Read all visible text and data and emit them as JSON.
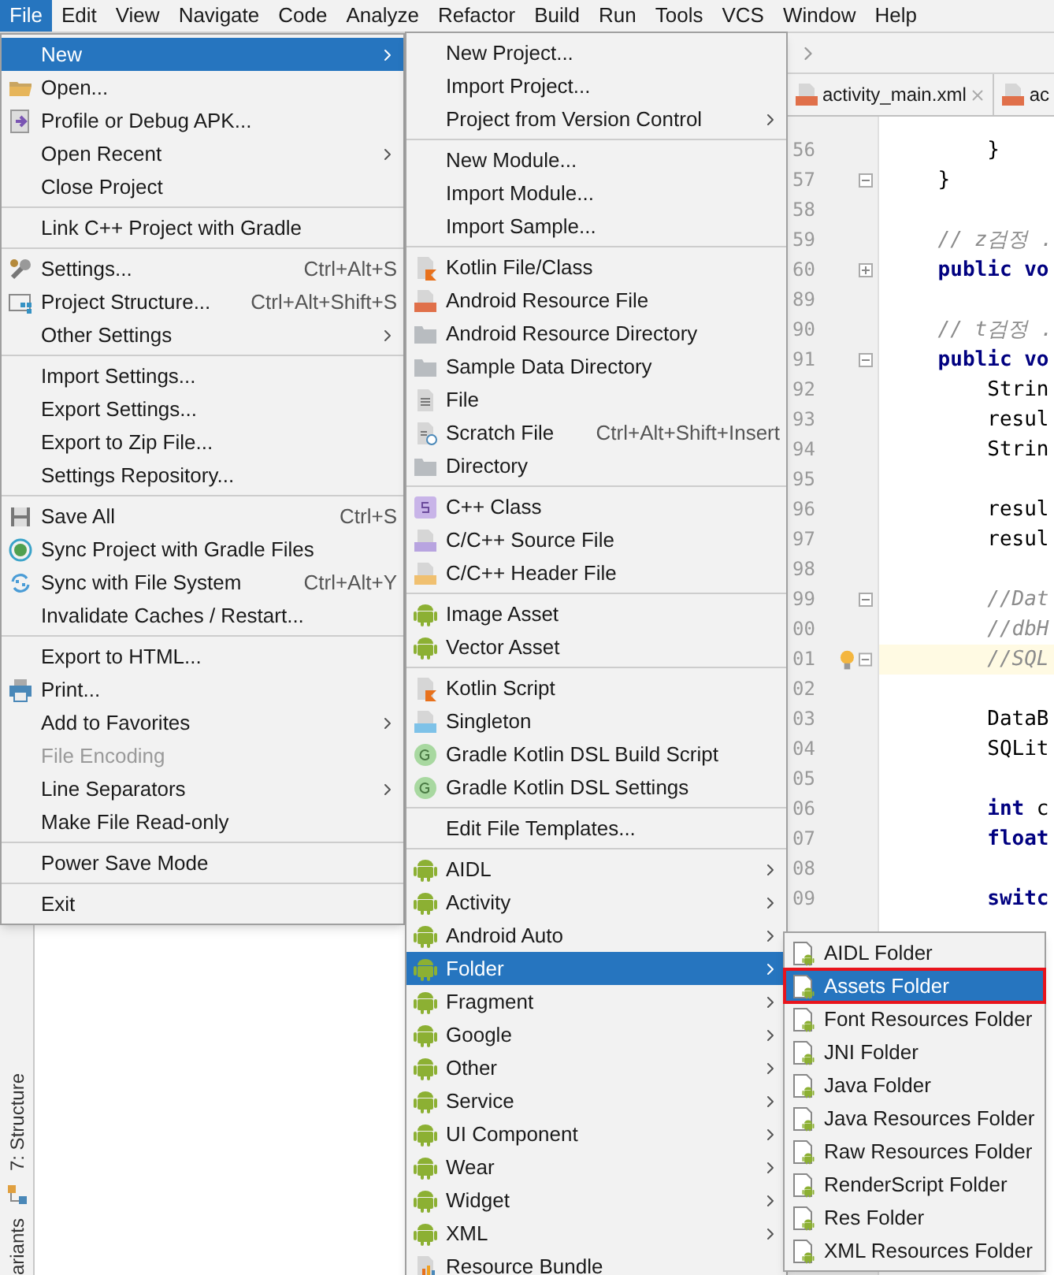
{
  "menu_bar": [
    {
      "label": "File",
      "selected": true
    },
    {
      "label": "Edit",
      "selected": false
    },
    {
      "label": "View",
      "selected": false
    },
    {
      "label": "Navigate",
      "selected": false
    },
    {
      "label": "Code",
      "selected": false
    },
    {
      "label": "Analyze",
      "selected": false
    },
    {
      "label": "Refactor",
      "selected": false
    },
    {
      "label": "Build",
      "selected": false
    },
    {
      "label": "Run",
      "selected": false
    },
    {
      "label": "Tools",
      "selected": false
    },
    {
      "label": "VCS",
      "selected": false
    },
    {
      "label": "Window",
      "selected": false
    },
    {
      "label": "Help",
      "selected": false
    }
  ],
  "tool_strip": {
    "labels": [
      "7: Structure",
      "ariants"
    ]
  },
  "editor": {
    "tabs": [
      {
        "label": "activity_main.xml",
        "closable": true
      },
      {
        "label": "ac",
        "closable": false
      }
    ],
    "lines": [
      {
        "number": "56",
        "kind": "code",
        "text": "        }",
        "foldable": false,
        "current": false
      },
      {
        "number": "57",
        "kind": "code",
        "text": "    }",
        "foldable": true,
        "collapsed": false,
        "current": false
      },
      {
        "number": "58",
        "kind": "blank",
        "foldable": false,
        "current": false
      },
      {
        "number": "59",
        "kind": "comment",
        "text": "    // z검정 .",
        "foldable": false,
        "current": false
      },
      {
        "number": "60",
        "kind": "keyword",
        "text": "    public vo",
        "foldable": true,
        "collapsed": true,
        "current": false
      },
      {
        "number": "89",
        "kind": "blank",
        "foldable": false,
        "current": false
      },
      {
        "number": "90",
        "kind": "comment",
        "text": "    // t검정 .",
        "foldable": false,
        "current": false
      },
      {
        "number": "91",
        "kind": "keyword",
        "text": "    public vo",
        "foldable": true,
        "collapsed": false,
        "current": false
      },
      {
        "number": "92",
        "kind": "code",
        "text": "        Strin",
        "foldable": false,
        "current": false
      },
      {
        "number": "93",
        "kind": "code",
        "text": "        resul",
        "foldable": false,
        "current": false
      },
      {
        "number": "94",
        "kind": "code",
        "text": "        Strin",
        "foldable": false,
        "current": false
      },
      {
        "number": "95",
        "kind": "blank",
        "foldable": false,
        "current": false
      },
      {
        "number": "96",
        "kind": "code",
        "text": "        resul",
        "foldable": false,
        "current": false
      },
      {
        "number": "97",
        "kind": "code",
        "text": "        resul",
        "foldable": false,
        "current": false
      },
      {
        "number": "98",
        "kind": "blank",
        "foldable": false,
        "current": false
      },
      {
        "number": "99",
        "kind": "comment",
        "text": "        //Dat",
        "foldable": true,
        "collapsed": false,
        "current": false
      },
      {
        "number": "00",
        "kind": "comment",
        "text": "        //dbH",
        "foldable": false,
        "current": false
      },
      {
        "number": "01",
        "kind": "comment",
        "text": "        //SQL",
        "foldable": true,
        "collapsed": false,
        "current": true
      },
      {
        "number": "02",
        "kind": "blank",
        "foldable": false,
        "current": false
      },
      {
        "number": "03",
        "kind": "code",
        "text": "        DataB",
        "foldable": false,
        "current": false
      },
      {
        "number": "04",
        "kind": "code",
        "text": "        SQLit",
        "foldable": false,
        "current": false
      },
      {
        "number": "05",
        "kind": "blank",
        "foldable": false,
        "current": false
      },
      {
        "number": "06",
        "kind": "code",
        "text": "        **int** c",
        "foldable": false,
        "current": false
      },
      {
        "number": "07",
        "kind": "keyword",
        "text": "        float",
        "foldable": false,
        "current": false
      },
      {
        "number": "08",
        "kind": "blank",
        "foldable": false,
        "current": false
      },
      {
        "number": "09",
        "kind": "keyword",
        "text": "        switc",
        "foldable": false,
        "current": false
      }
    ]
  },
  "file_menu": [
    {
      "kind": "item",
      "label": "New",
      "submenu": true,
      "disabled": false,
      "selected": true
    },
    {
      "kind": "item",
      "label": "Open...",
      "submenu": false,
      "disabled": false,
      "selected": false
    },
    {
      "kind": "item",
      "label": "Profile or Debug APK...",
      "submenu": false,
      "disabled": false,
      "selected": false
    },
    {
      "kind": "item",
      "label": "Open Recent",
      "submenu": true,
      "disabled": false,
      "selected": false
    },
    {
      "kind": "item",
      "label": "Close Project",
      "submenu": false,
      "disabled": false,
      "selected": false
    },
    {
      "kind": "separator"
    },
    {
      "kind": "item",
      "label": "Link C++ Project with Gradle",
      "submenu": false,
      "disabled": false,
      "selected": false
    },
    {
      "kind": "separator"
    },
    {
      "kind": "item",
      "label": "Settings...",
      "shortcut": "Ctrl+Alt+S",
      "submenu": false,
      "disabled": false,
      "selected": false
    },
    {
      "kind": "item",
      "label": "Project Structure...",
      "shortcut": "Ctrl+Alt+Shift+S",
      "submenu": false,
      "disabled": false,
      "selected": false
    },
    {
      "kind": "item",
      "label": "Other Settings",
      "submenu": true,
      "disabled": false,
      "selected": false
    },
    {
      "kind": "separator"
    },
    {
      "kind": "item",
      "label": "Import Settings...",
      "submenu": false,
      "disabled": false,
      "selected": false
    },
    {
      "kind": "item",
      "label": "Export Settings...",
      "submenu": false,
      "disabled": false,
      "selected": false
    },
    {
      "kind": "item",
      "label": "Export to Zip File...",
      "submenu": false,
      "disabled": false,
      "selected": false
    },
    {
      "kind": "item",
      "label": "Settings Repository...",
      "submenu": false,
      "disabled": false,
      "selected": false
    },
    {
      "kind": "separator"
    },
    {
      "kind": "item",
      "label": "Save All",
      "shortcut": "Ctrl+S",
      "submenu": false,
      "disabled": false,
      "selected": false
    },
    {
      "kind": "item",
      "label": "Sync Project with Gradle Files",
      "submenu": false,
      "disabled": false,
      "selected": false
    },
    {
      "kind": "item",
      "label": "Sync with File System",
      "shortcut": "Ctrl+Alt+Y",
      "submenu": false,
      "disabled": false,
      "selected": false
    },
    {
      "kind": "item",
      "label": "Invalidate Caches / Restart...",
      "submenu": false,
      "disabled": false,
      "selected": false
    },
    {
      "kind": "separator"
    },
    {
      "kind": "item",
      "label": "Export to HTML...",
      "submenu": false,
      "disabled": false,
      "selected": false
    },
    {
      "kind": "item",
      "label": "Print...",
      "submenu": false,
      "disabled": false,
      "selected": false
    },
    {
      "kind": "item",
      "label": "Add to Favorites",
      "submenu": true,
      "disabled": false,
      "selected": false
    },
    {
      "kind": "item",
      "label": "File Encoding",
      "submenu": false,
      "disabled": true,
      "selected": false
    },
    {
      "kind": "item",
      "label": "Line Separators",
      "submenu": true,
      "disabled": false,
      "selected": false
    },
    {
      "kind": "item",
      "label": "Make File Read-only",
      "submenu": false,
      "disabled": false,
      "selected": false
    },
    {
      "kind": "separator"
    },
    {
      "kind": "item",
      "label": "Power Save Mode",
      "submenu": false,
      "disabled": false,
      "selected": false
    },
    {
      "kind": "separator"
    },
    {
      "kind": "item",
      "label": "Exit",
      "submenu": false,
      "disabled": false,
      "selected": false
    }
  ],
  "new_menu": [
    {
      "kind": "item",
      "label": "New Project...",
      "submenu": false,
      "selected": false
    },
    {
      "kind": "item",
      "label": "Import Project...",
      "submenu": false,
      "selected": false
    },
    {
      "kind": "item",
      "label": "Project from Version Control",
      "submenu": true,
      "selected": false
    },
    {
      "kind": "separator"
    },
    {
      "kind": "item",
      "label": "New Module...",
      "submenu": false,
      "selected": false
    },
    {
      "kind": "item",
      "label": "Import Module...",
      "submenu": false,
      "selected": false
    },
    {
      "kind": "item",
      "label": "Import Sample...",
      "submenu": false,
      "selected": false
    },
    {
      "kind": "separator"
    },
    {
      "kind": "item",
      "label": "Kotlin File/Class",
      "submenu": false,
      "selected": false
    },
    {
      "kind": "item",
      "label": "Android Resource File",
      "submenu": false,
      "selected": false
    },
    {
      "kind": "item",
      "label": "Android Resource Directory",
      "submenu": false,
      "selected": false
    },
    {
      "kind": "item",
      "label": "Sample Data Directory",
      "submenu": false,
      "selected": false
    },
    {
      "kind": "item",
      "label": "File",
      "submenu": false,
      "selected": false
    },
    {
      "kind": "item",
      "label": "Scratch File",
      "shortcut": "Ctrl+Alt+Shift+Insert",
      "submenu": false,
      "selected": false
    },
    {
      "kind": "item",
      "label": "Directory",
      "submenu": false,
      "selected": false
    },
    {
      "kind": "separator"
    },
    {
      "kind": "item",
      "label": "C++ Class",
      "submenu": false,
      "selected": false
    },
    {
      "kind": "item",
      "label": "C/C++ Source File",
      "submenu": false,
      "selected": false
    },
    {
      "kind": "item",
      "label": "C/C++ Header File",
      "submenu": false,
      "selected": false
    },
    {
      "kind": "separator"
    },
    {
      "kind": "item",
      "label": "Image Asset",
      "submenu": false,
      "selected": false
    },
    {
      "kind": "item",
      "label": "Vector Asset",
      "submenu": false,
      "selected": false
    },
    {
      "kind": "separator"
    },
    {
      "kind": "item",
      "label": "Kotlin Script",
      "submenu": false,
      "selected": false
    },
    {
      "kind": "item",
      "label": "Singleton",
      "submenu": false,
      "selected": false
    },
    {
      "kind": "item",
      "label": "Gradle Kotlin DSL Build Script",
      "submenu": false,
      "selected": false
    },
    {
      "kind": "item",
      "label": "Gradle Kotlin DSL Settings",
      "submenu": false,
      "selected": false
    },
    {
      "kind": "separator"
    },
    {
      "kind": "item",
      "label": "Edit File Templates...",
      "submenu": false,
      "selected": false
    },
    {
      "kind": "separator"
    },
    {
      "kind": "item",
      "label": "AIDL",
      "submenu": true,
      "selected": false
    },
    {
      "kind": "item",
      "label": "Activity",
      "submenu": true,
      "selected": false
    },
    {
      "kind": "item",
      "label": "Android Auto",
      "submenu": true,
      "selected": false
    },
    {
      "kind": "item",
      "label": "Folder",
      "submenu": true,
      "selected": true
    },
    {
      "kind": "item",
      "label": "Fragment",
      "submenu": true,
      "selected": false
    },
    {
      "kind": "item",
      "label": "Google",
      "submenu": true,
      "selected": false
    },
    {
      "kind": "item",
      "label": "Other",
      "submenu": true,
      "selected": false
    },
    {
      "kind": "item",
      "label": "Service",
      "submenu": true,
      "selected": false
    },
    {
      "kind": "item",
      "label": "UI Component",
      "submenu": true,
      "selected": false
    },
    {
      "kind": "item",
      "label": "Wear",
      "submenu": true,
      "selected": false
    },
    {
      "kind": "item",
      "label": "Widget",
      "submenu": true,
      "selected": false
    },
    {
      "kind": "item",
      "label": "XML",
      "submenu": true,
      "selected": false
    },
    {
      "kind": "item",
      "label": "Resource Bundle",
      "submenu": false,
      "selected": false
    }
  ],
  "folder_menu": [
    {
      "kind": "item",
      "label": "AIDL Folder",
      "selected": false,
      "marked": false
    },
    {
      "kind": "item",
      "label": "Assets Folder",
      "selected": true,
      "marked": true
    },
    {
      "kind": "item",
      "label": "Font Resources Folder",
      "selected": false,
      "marked": false
    },
    {
      "kind": "item",
      "label": "JNI Folder",
      "selected": false,
      "marked": false
    },
    {
      "kind": "item",
      "label": "Java Folder",
      "selected": false,
      "marked": false
    },
    {
      "kind": "item",
      "label": "Java Resources Folder",
      "selected": false,
      "marked": false
    },
    {
      "kind": "item",
      "label": "Raw Resources Folder",
      "selected": false,
      "marked": false
    },
    {
      "kind": "item",
      "label": "RenderScript Folder",
      "selected": false,
      "marked": false
    },
    {
      "kind": "item",
      "label": "Res Folder",
      "selected": false,
      "marked": false
    },
    {
      "kind": "item",
      "label": "XML Resources Folder",
      "selected": false,
      "marked": false
    }
  ]
}
